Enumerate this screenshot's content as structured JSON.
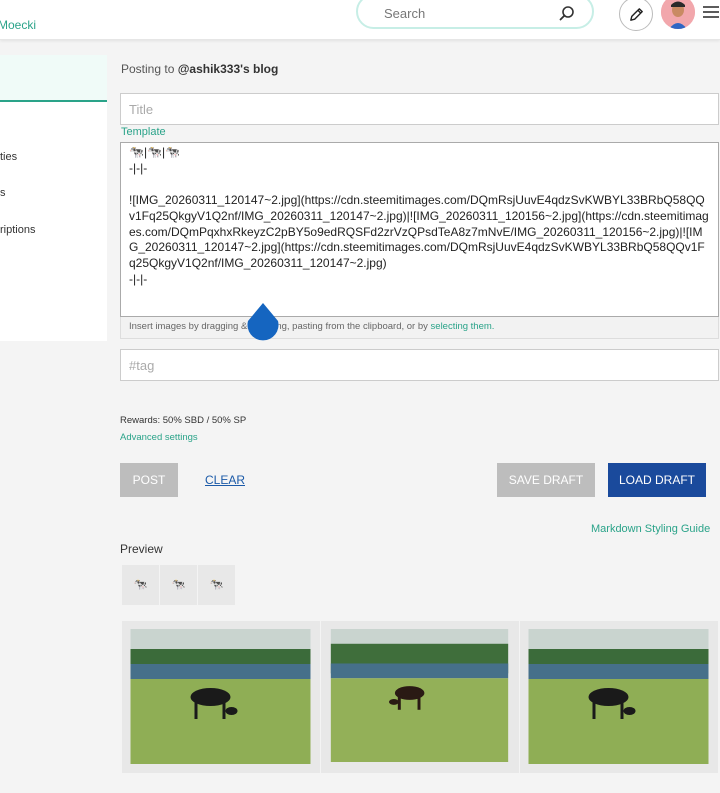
{
  "header": {
    "username": "Moecki",
    "search_placeholder": "Search"
  },
  "sidebar": {
    "items": [
      {
        "label": "ties"
      },
      {
        "label": "s"
      },
      {
        "label": "riptions"
      }
    ]
  },
  "form": {
    "posting_prefix": "Posting to",
    "posting_blog": "@ashik333's blog",
    "title_placeholder": "Title",
    "template_label": "Template",
    "body_text": "🐄|🐄|🐄\n-|-|-\n\n![IMG_20260311_120147~2.jpg](https://cdn.steemitimages.com/DQmRsjUuvE4qdzSvKWBYL33BRbQ58QQv1Fq25QkgyV1Q2nf/IMG_20260311_120147~2.jpg)|![IMG_20260311_120156~2.jpg](https://cdn.steemitimages.com/DQmPqxhxRkeyzC2pBY5o9edRQSFd2zrVzQPsdTeA8z7mNvE/IMG_20260311_120156~2.jpg)|![IMG_20260311_120147~2.jpg](https://cdn.steemitimages.com/DQmRsjUuvE4qdzSvKWBYL33BRbQ58QQv1Fq25QkgyV1Q2nf/IMG_20260311_120147~2.jpg)\n-|-|-",
    "dropzone_text": "Insert images by dragging & dropping, pasting from the clipboard, or by",
    "dropzone_link": "selecting them.",
    "tag_placeholder": "#tag",
    "rewards": "Rewards: 50% SBD / 50% SP",
    "advanced": "Advanced settings"
  },
  "buttons": {
    "post": "POST",
    "clear": "CLEAR",
    "save_draft": "SAVE DRAFT",
    "load_draft": "LOAD DRAFT"
  },
  "preview": {
    "markdown_guide": "Markdown Styling Guide",
    "label": "Preview",
    "header_cells": [
      "🐄",
      "🐄",
      "🐄"
    ]
  },
  "colors": {
    "accent": "#2aa389",
    "primary_button": "#1a4a9c",
    "drag_handle": "#1565c0"
  }
}
